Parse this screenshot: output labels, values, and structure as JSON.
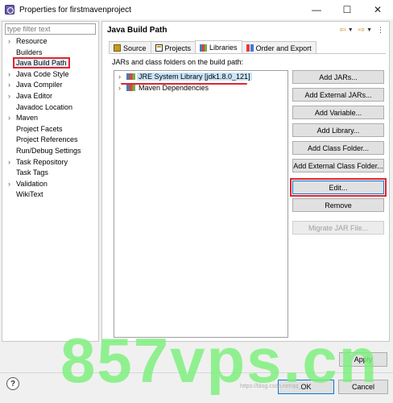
{
  "window": {
    "title": "Properties for firstmavenproject",
    "minimize_glyph": "—",
    "maximize_glyph": "☐",
    "close_glyph": "✕"
  },
  "filter": {
    "placeholder": "type filter text"
  },
  "tree": {
    "items": [
      {
        "label": "Resource",
        "expandable": true
      },
      {
        "label": "Builders",
        "expandable": false
      },
      {
        "label": "Java Build Path",
        "expandable": false,
        "selected": true
      },
      {
        "label": "Java Code Style",
        "expandable": true
      },
      {
        "label": "Java Compiler",
        "expandable": true
      },
      {
        "label": "Java Editor",
        "expandable": true
      },
      {
        "label": "Javadoc Location",
        "expandable": false
      },
      {
        "label": "Maven",
        "expandable": true
      },
      {
        "label": "Project Facets",
        "expandable": false
      },
      {
        "label": "Project References",
        "expandable": false
      },
      {
        "label": "Run/Debug Settings",
        "expandable": false
      },
      {
        "label": "Task Repository",
        "expandable": true
      },
      {
        "label": "Task Tags",
        "expandable": false
      },
      {
        "label": "Validation",
        "expandable": true
      },
      {
        "label": "WikiText",
        "expandable": false
      }
    ]
  },
  "page": {
    "title": "Java Build Path",
    "tabs": [
      {
        "label": "Source",
        "icon": "source-folder-icon"
      },
      {
        "label": "Projects",
        "icon": "projects-icon"
      },
      {
        "label": "Libraries",
        "icon": "libraries-icon",
        "active": true
      },
      {
        "label": "Order and Export",
        "icon": "order-export-icon"
      }
    ],
    "jars_label": "JARs and class folders on the build path:",
    "libraries": [
      {
        "label": "JRE System Library [jdk1.8.0_121]",
        "selected": true
      },
      {
        "label": "Maven Dependencies",
        "selected": false
      }
    ],
    "buttons": {
      "add_jars": "Add JARs...",
      "add_external_jars": "Add External JARs...",
      "add_variable": "Add Variable...",
      "add_library": "Add Library...",
      "add_class_folder": "Add Class Folder...",
      "add_external_class_folder": "Add External Class Folder...",
      "edit": "Edit...",
      "remove": "Remove",
      "migrate_jar": "Migrate JAR File..."
    }
  },
  "footer": {
    "apply": "Apply",
    "ok": "OK",
    "cancel": "Cancel",
    "help_glyph": "?"
  },
  "watermark": {
    "text": "857vps.cn",
    "small_text": "https://blog.csdn.net/qq_..."
  },
  "colors": {
    "highlight_red": "#e0262e",
    "watermark_green": "#7cf07c",
    "selection_blue": "#cce4f7"
  }
}
